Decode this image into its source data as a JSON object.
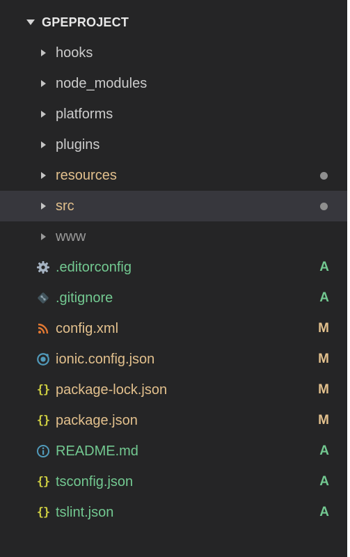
{
  "explorer": {
    "project_title": "GPEPROJECT"
  },
  "colors": {
    "background": "#252526",
    "selected_row": "#37373d",
    "folder_text": "#cccccc",
    "dim_folder_text": "#9a9a9a",
    "added_green": "#73c991",
    "modified_yellow": "#e2c08d",
    "dot_gray": "#8f8f8f"
  },
  "tree": {
    "items": [
      {
        "label": "hooks",
        "icon": "chevron-right-icon"
      },
      {
        "label": "node_modules",
        "icon": "chevron-right-icon"
      },
      {
        "label": "platforms",
        "icon": "chevron-right-icon"
      },
      {
        "label": "plugins",
        "icon": "chevron-right-icon"
      },
      {
        "label": "resources",
        "icon": "chevron-right-icon",
        "status_dot": true
      },
      {
        "label": "src",
        "icon": "chevron-right-icon",
        "status_dot": true,
        "selected": true
      },
      {
        "label": "www",
        "icon": "chevron-right-icon"
      },
      {
        "label": ".editorconfig",
        "icon": "gear-icon",
        "status": "A"
      },
      {
        "label": ".gitignore",
        "icon": "git-icon",
        "status": "A"
      },
      {
        "label": "config.xml",
        "icon": "rss-icon",
        "status": "M"
      },
      {
        "label": "ionic.config.json",
        "icon": "ionic-icon",
        "status": "M"
      },
      {
        "label": "package-lock.json",
        "icon": "json-braces-icon",
        "status": "M"
      },
      {
        "label": "package.json",
        "icon": "json-braces-icon",
        "status": "M"
      },
      {
        "label": "README.md",
        "icon": "info-icon",
        "status": "A"
      },
      {
        "label": "tsconfig.json",
        "icon": "json-braces-icon",
        "status": "A"
      },
      {
        "label": "tslint.json",
        "icon": "json-braces-icon",
        "status": "A"
      }
    ]
  }
}
